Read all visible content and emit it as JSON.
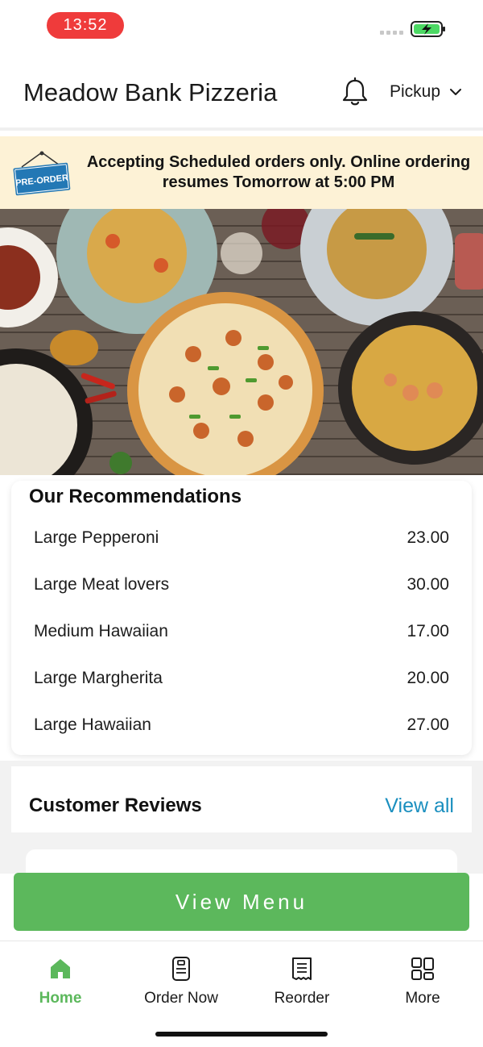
{
  "status_bar": {
    "time": "13:52"
  },
  "header": {
    "title": "Meadow Bank Pizzeria",
    "mode": "Pickup"
  },
  "notice": {
    "badge": "PRE-ORDER",
    "text": "Accepting Scheduled orders only. Online ordering resumes Tomorrow at 5:00 PM"
  },
  "recommendations": {
    "title": "Our Recommendations",
    "items": [
      {
        "name": "Large Pepperoni",
        "price": "23.00"
      },
      {
        "name": "Large Meat lovers",
        "price": "30.00"
      },
      {
        "name": "Medium Hawaiian",
        "price": "17.00"
      },
      {
        "name": "Large Margherita",
        "price": "20.00"
      },
      {
        "name": "Large Hawaiian",
        "price": "27.00"
      }
    ]
  },
  "reviews": {
    "title": "Customer Reviews",
    "view_all": "View all"
  },
  "cta": {
    "label": "View Menu"
  },
  "tabs": [
    {
      "label": "Home",
      "icon": "home-icon",
      "active": true
    },
    {
      "label": "Order Now",
      "icon": "order-icon",
      "active": false
    },
    {
      "label": "Reorder",
      "icon": "receipt-icon",
      "active": false
    },
    {
      "label": "More",
      "icon": "grid-icon",
      "active": false
    }
  ],
  "colors": {
    "accent": "#5cb85c",
    "link": "#1b8fbf",
    "notice_bg": "#fdf2d6",
    "time_pill": "#ef3b3b"
  }
}
